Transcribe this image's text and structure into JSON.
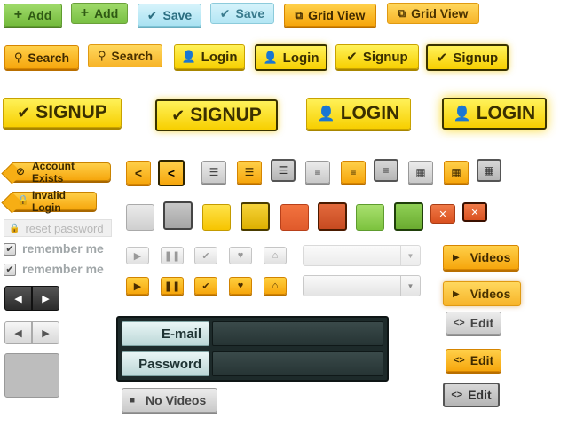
{
  "row1": {
    "add_label": "Add",
    "save_label": "Save",
    "gridview_label": "Grid View"
  },
  "row2": {
    "search_label": "Search",
    "login_label": "Login",
    "signup_label": "Signup"
  },
  "row3": {
    "signup_label": "SIGNUP",
    "login_label": "LOGIN"
  },
  "tags": {
    "account_exists": "Account Exists",
    "invalid_login": "Invalid Login"
  },
  "form_left": {
    "reset_password": "reset password",
    "remember_me_1": "remember me",
    "remember_me_2": "remember me"
  },
  "login_form": {
    "email_label": "E-mail",
    "password_label": "Password",
    "email_value": "",
    "password_value": ""
  },
  "right_buttons": {
    "videos_label": "Videos",
    "edit_label": "Edit",
    "no_videos_label": "No Videos"
  },
  "colors": {
    "accent_orange": "#f6a60c",
    "accent_yellow": "#f7cf00",
    "accent_green": "#74bb3c",
    "accent_blue": "#a9e2f2",
    "accent_red": "#e05a2b",
    "form_bg": "#1f2b2b"
  }
}
